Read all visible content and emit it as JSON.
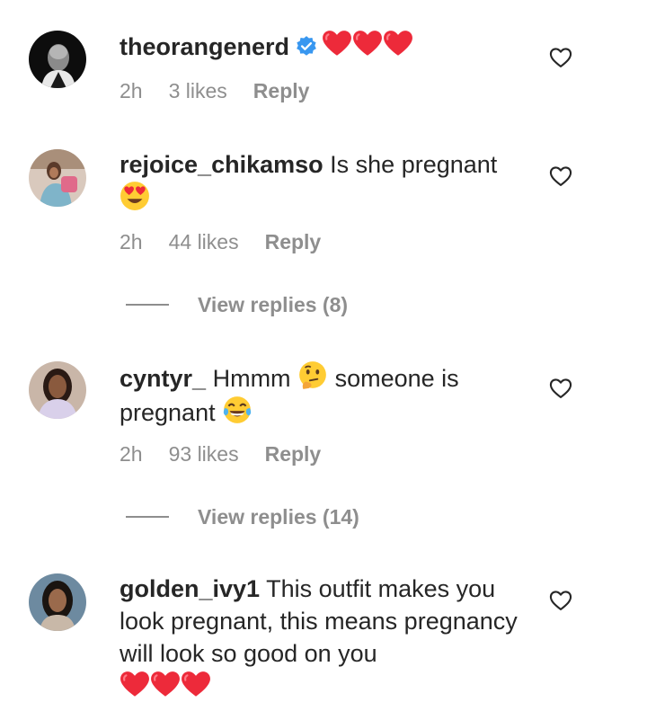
{
  "comments": [
    {
      "username": "theorangenerd",
      "verified": true,
      "text": "",
      "emojis": [
        "heart",
        "heart",
        "heart"
      ],
      "time": "2h",
      "likes": "3 likes",
      "reply": "Reply",
      "icons": {
        "avatar": "avatar-man-bald",
        "like": "heart-outline-icon"
      }
    },
    {
      "username": "rejoice_chikamso",
      "text": "Is she pregnant",
      "emojis": [
        "heart-eyes"
      ],
      "time": "2h",
      "likes": "44 likes",
      "reply": "Reply",
      "view_replies": "View replies (8)"
    },
    {
      "username": "cyntyr_",
      "text_parts": [
        "Hmmm",
        "someone is pregnant"
      ],
      "emojis": [
        "thinking-face",
        "tears-of-joy"
      ],
      "time": "2h",
      "likes": "93 likes",
      "reply": "Reply",
      "view_replies": "View replies (14)"
    },
    {
      "username": "golden_ivy1",
      "text": "This outfit makes you look pregnant, this means pregnancy will look so good on you",
      "emojis": [
        "heart",
        "heart",
        "heart"
      ]
    }
  ],
  "colors": {
    "text": "#262626",
    "muted": "#8e8e8e",
    "verified": "#3897f0",
    "heart": "#ed4956"
  }
}
